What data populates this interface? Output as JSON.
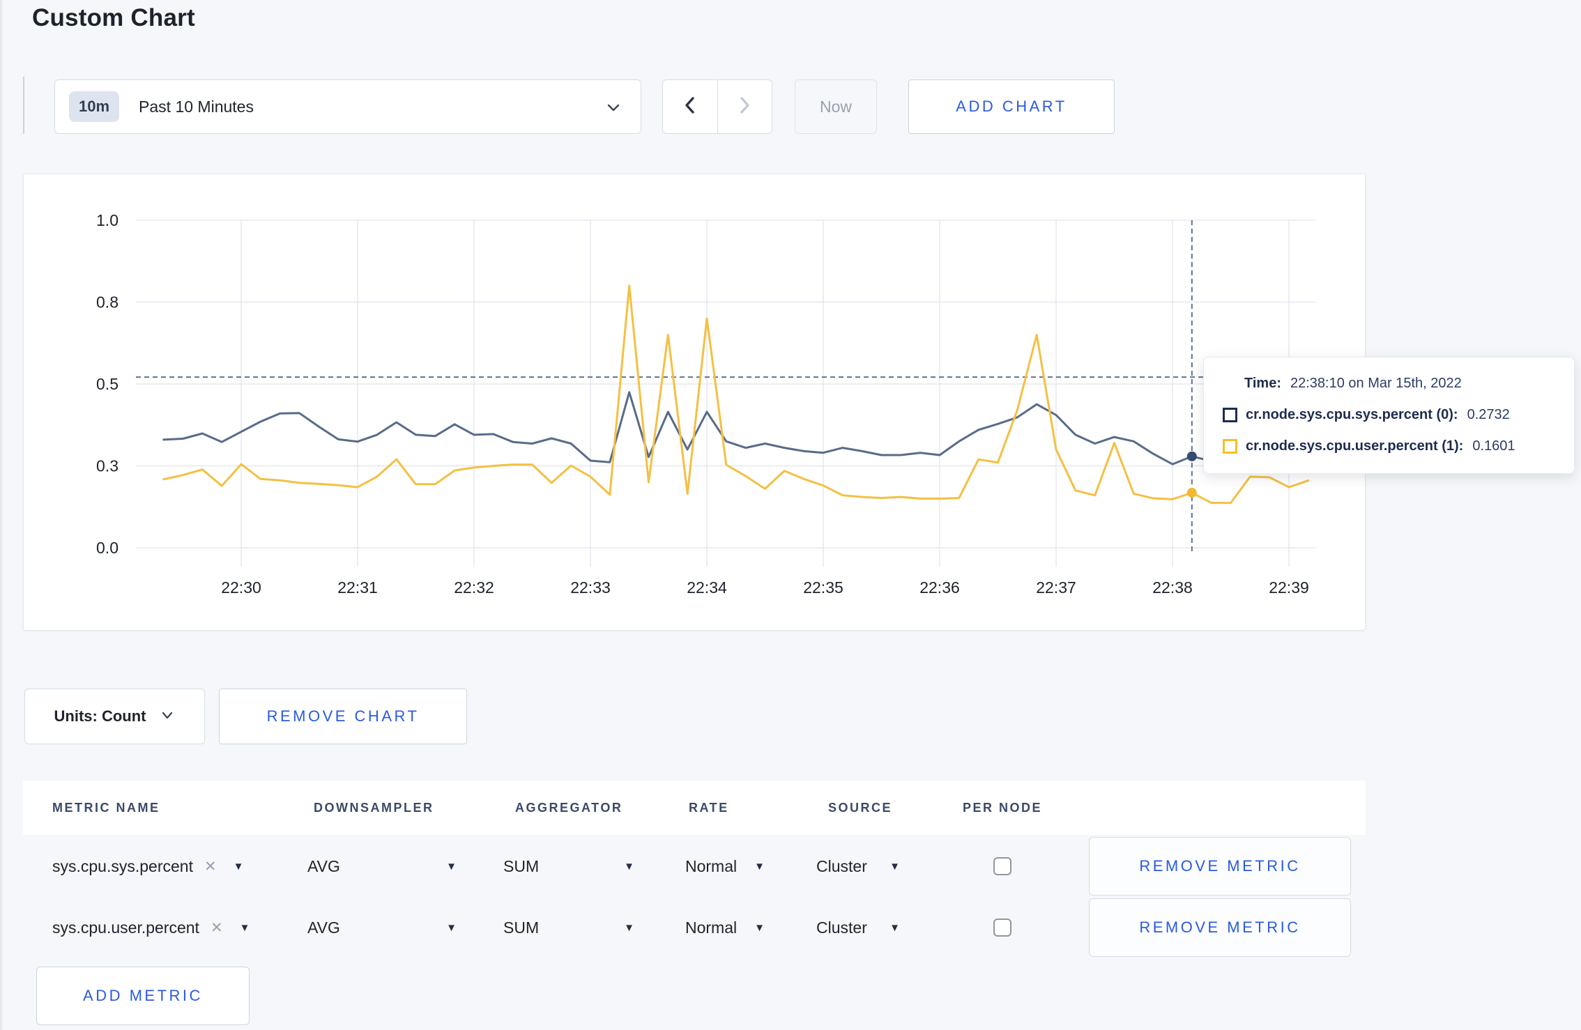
{
  "page": {
    "title": "Custom Chart"
  },
  "colors": {
    "accent_blue": "#2a5ae0",
    "series_sys_line": "#596b89",
    "series_user_line": "#f4c043",
    "swatch_sys": "#1d2b50",
    "swatch_user": "#f6bf26",
    "crosshair": "#5e7190"
  },
  "toolbar": {
    "time_window_badge": "10m",
    "time_window_label": "Past 10 Minutes",
    "now_label": "Now",
    "add_chart_label": "ADD CHART"
  },
  "icons": {
    "time_window": "chevron-down",
    "prev": "chevron-left",
    "next": "chevron-right",
    "units": "chevron-down",
    "metric_remove": "x",
    "dropdown_caret": "caret-down"
  },
  "chart_data": {
    "type": "line",
    "title": "",
    "xlabel": "",
    "ylabel": "",
    "ylim": [
      0,
      1
    ],
    "grid": true,
    "legend_position": "none",
    "yticks": [
      {
        "v": 0,
        "label": "0.0"
      },
      {
        "v": 0.25,
        "label": "0.3"
      },
      {
        "v": 0.5,
        "label": "0.5"
      },
      {
        "v": 0.75,
        "label": "0.8"
      },
      {
        "v": 1.0,
        "label": "1.0"
      }
    ],
    "xticks": [
      "22:30",
      "22:31",
      "22:32",
      "22:33",
      "22:34",
      "22:35",
      "22:36",
      "22:37",
      "22:38",
      "22:39"
    ],
    "x": [
      "22:29:20",
      "22:29:30",
      "22:29:40",
      "22:29:50",
      "22:30:00",
      "22:30:10",
      "22:30:20",
      "22:30:30",
      "22:30:40",
      "22:30:50",
      "22:31:00",
      "22:31:10",
      "22:31:20",
      "22:31:30",
      "22:31:40",
      "22:31:50",
      "22:32:00",
      "22:32:10",
      "22:32:20",
      "22:32:30",
      "22:32:40",
      "22:32:50",
      "22:33:00",
      "22:33:10",
      "22:33:20",
      "22:33:30",
      "22:33:40",
      "22:33:50",
      "22:34:00",
      "22:34:10",
      "22:34:20",
      "22:34:30",
      "22:34:40",
      "22:34:50",
      "22:35:00",
      "22:35:10",
      "22:35:20",
      "22:35:30",
      "22:35:40",
      "22:35:50",
      "22:36:00",
      "22:36:10",
      "22:36:20",
      "22:36:30",
      "22:36:40",
      "22:36:50",
      "22:37:00",
      "22:37:10",
      "22:37:20",
      "22:37:30",
      "22:37:40",
      "22:37:50",
      "22:38:00",
      "22:38:10",
      "22:38:20",
      "22:38:30",
      "22:38:40",
      "22:38:50",
      "22:39:00",
      "22:39:10"
    ],
    "series": [
      {
        "name": "cr.node.sys.cpu.sys.percent (0)",
        "color": "#596b89",
        "dot_color": "#384b70",
        "values": [
          0.33,
          0.333,
          0.349,
          0.323,
          0.354,
          0.385,
          0.41,
          0.411,
          0.37,
          0.331,
          0.324,
          0.345,
          0.383,
          0.345,
          0.341,
          0.377,
          0.345,
          0.347,
          0.323,
          0.318,
          0.334,
          0.318,
          0.266,
          0.261,
          0.475,
          0.277,
          0.415,
          0.3,
          0.415,
          0.325,
          0.305,
          0.318,
          0.305,
          0.295,
          0.29,
          0.305,
          0.295,
          0.283,
          0.283,
          0.29,
          0.283,
          0.325,
          0.36,
          0.378,
          0.398,
          0.438,
          0.405,
          0.345,
          0.318,
          0.338,
          0.325,
          0.287,
          0.255,
          0.279,
          0.265,
          0.27,
          0.275,
          0.27,
          0.275,
          0.31
        ]
      },
      {
        "name": "cr.node.sys.cpu.user.percent (1)",
        "color": "#f4c043",
        "dot_color": "#f0b92e",
        "values": [
          0.209,
          0.222,
          0.239,
          0.189,
          0.255,
          0.21,
          0.206,
          0.198,
          0.195,
          0.191,
          0.185,
          0.217,
          0.27,
          0.194,
          0.194,
          0.236,
          0.245,
          0.25,
          0.254,
          0.254,
          0.198,
          0.251,
          0.217,
          0.162,
          0.8,
          0.2,
          0.65,
          0.165,
          0.7,
          0.253,
          0.219,
          0.18,
          0.235,
          0.21,
          0.19,
          0.16,
          0.155,
          0.152,
          0.155,
          0.15,
          0.15,
          0.152,
          0.27,
          0.26,
          0.42,
          0.65,
          0.3,
          0.175,
          0.16,
          0.32,
          0.165,
          0.151,
          0.148,
          0.168,
          0.137,
          0.137,
          0.217,
          0.215,
          0.185,
          0.205
        ]
      }
    ]
  },
  "hover": {
    "index": 53,
    "time": "22:38:10",
    "crosshair_value": 0.521,
    "sys_value": 0.2732,
    "user_value": 0.1601
  },
  "tooltip": {
    "time_label": "Time:",
    "time_value": "22:38:10 on Mar 15th, 2022",
    "rows": [
      {
        "label": "cr.node.sys.cpu.sys.percent (0):",
        "value": "0.2732",
        "color": "#1d2b50"
      },
      {
        "label": "cr.node.sys.cpu.user.percent (1):",
        "value": "0.1601",
        "color": "#f6bf26"
      }
    ]
  },
  "units_bar": {
    "units_label": "Units: Count",
    "remove_chart_label": "REMOVE CHART"
  },
  "metrics_table": {
    "headers": [
      "METRIC NAME",
      "DOWNSAMPLER",
      "AGGREGATOR",
      "RATE",
      "SOURCE",
      "PER NODE"
    ],
    "rows": [
      {
        "metric": "sys.cpu.sys.percent",
        "downsampler": "AVG",
        "aggregator": "SUM",
        "rate": "Normal",
        "source": "Cluster",
        "per_node": false,
        "remove_label": "REMOVE METRIC"
      },
      {
        "metric": "sys.cpu.user.percent",
        "downsampler": "AVG",
        "aggregator": "SUM",
        "rate": "Normal",
        "source": "Cluster",
        "per_node": false,
        "remove_label": "REMOVE METRIC"
      }
    ],
    "add_metric_label": "ADD METRIC"
  }
}
